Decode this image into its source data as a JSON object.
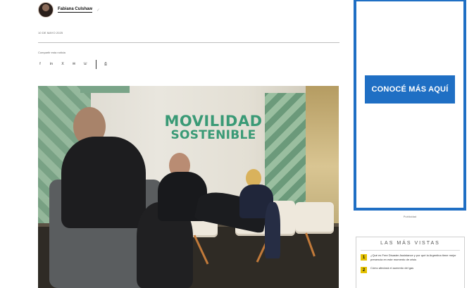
{
  "author": {
    "name": "Fabiana Culshaw",
    "verified_icon": "check-badge-icon"
  },
  "article": {
    "date": "10 DE MAYO 2025",
    "share_label": "Compartir esta noticia",
    "share_icons": [
      "facebook-icon",
      "linkedin-icon",
      "x-icon",
      "email-icon",
      "whatsapp-icon",
      "print-icon"
    ],
    "share_glyphs": [
      "f",
      "in",
      "X",
      "✉",
      "☏",
      "⎙"
    ],
    "photo": {
      "sign_line1": "MOVILIDAD",
      "sign_line2": "SOSTENIBLE"
    }
  },
  "ad": {
    "button_label": "CONOCÉ MÁS AQUÍ",
    "caption": "Publicidad"
  },
  "most_viewed": {
    "title": "LAS MÁS VISTAS",
    "items": [
      {
        "rank": "1",
        "text": "¿Qué es Free Disaster Assistance y por qué la Argentina tiene mejor presencia en este momento de crisis"
      },
      {
        "rank": "2",
        "text": "Cómo afectará el aumento del gas"
      }
    ]
  },
  "colors": {
    "accent_blue": "#1f6fc4",
    "rank_yellow": "#e5c200",
    "sign_green": "#3a9a76"
  }
}
